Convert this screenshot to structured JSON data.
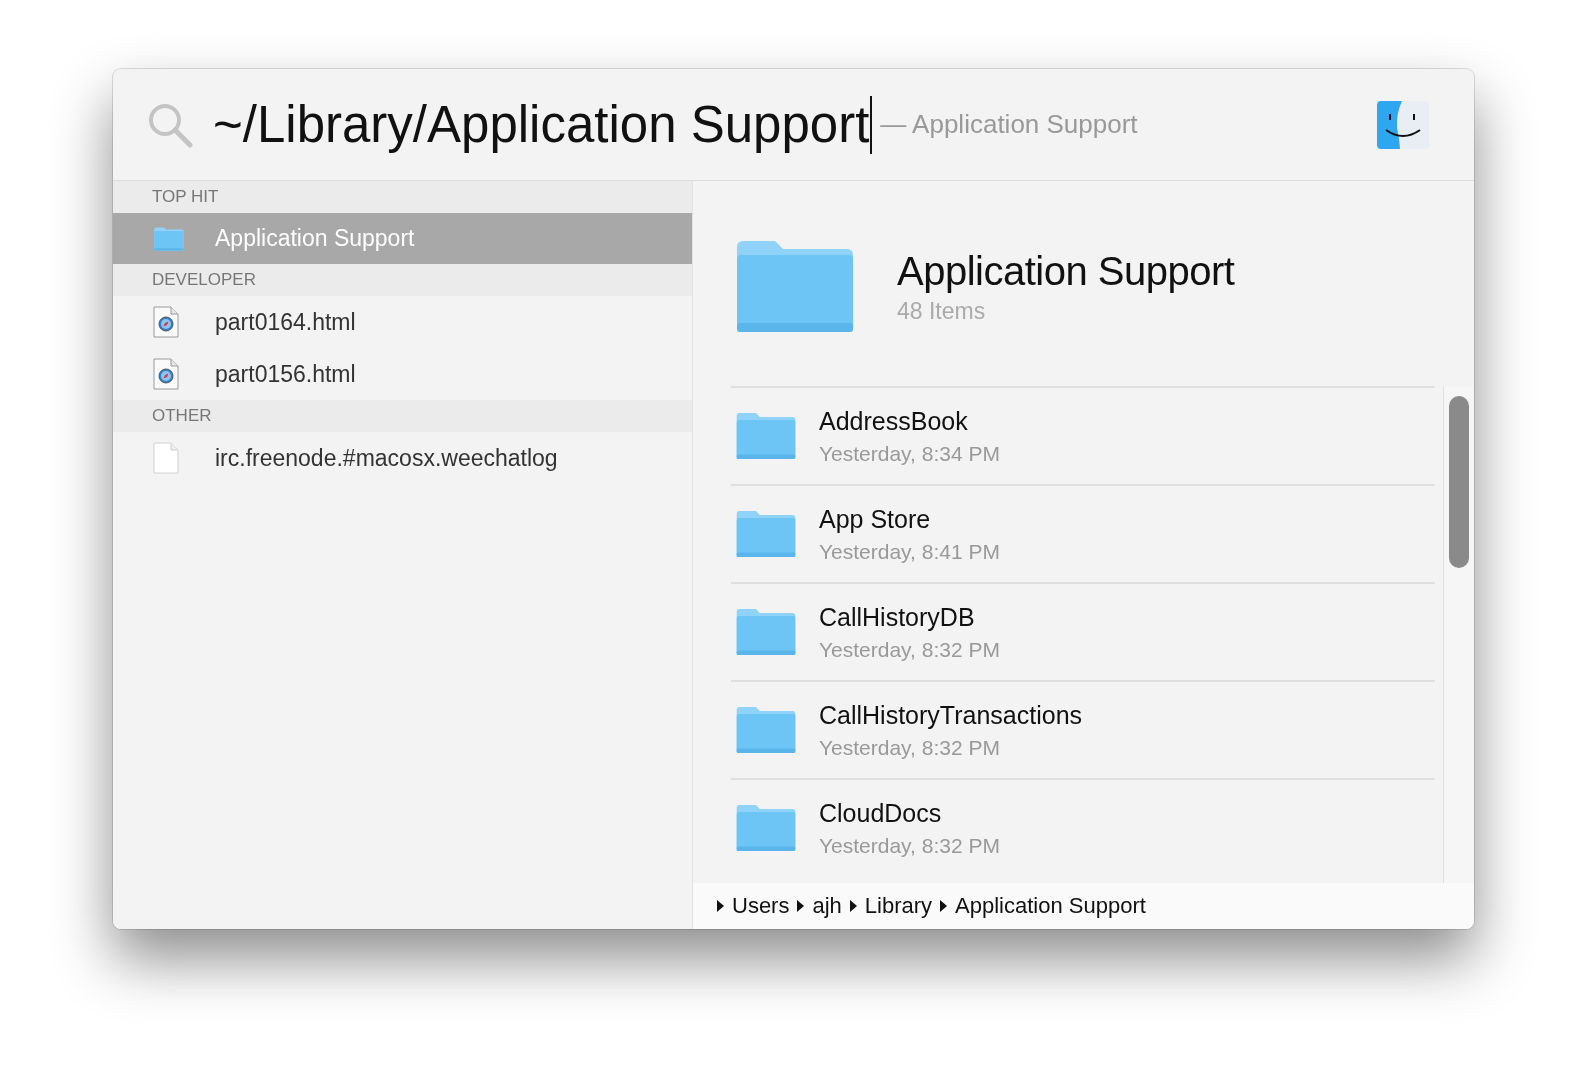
{
  "search": {
    "query": "~/Library/Application Support",
    "completion": "— Application Support"
  },
  "results": [
    {
      "section": "TOP HIT",
      "items": [
        {
          "name": "Application Support",
          "kind": "folder",
          "selected": true
        }
      ]
    },
    {
      "section": "DEVELOPER",
      "items": [
        {
          "name": "part0164.html",
          "kind": "html",
          "selected": false
        },
        {
          "name": "part0156.html",
          "kind": "html",
          "selected": false
        }
      ]
    },
    {
      "section": "OTHER",
      "items": [
        {
          "name": "irc.freenode.#macosx.weechatlog",
          "kind": "document",
          "selected": false
        }
      ]
    }
  ],
  "preview": {
    "title": "Application Support",
    "subtitle": "48 Items",
    "contents": [
      {
        "name": "AddressBook",
        "modified": "Yesterday, 8:34 PM"
      },
      {
        "name": "App Store",
        "modified": "Yesterday, 8:41 PM"
      },
      {
        "name": "CallHistoryDB",
        "modified": "Yesterday, 8:32 PM"
      },
      {
        "name": "CallHistoryTransactions",
        "modified": "Yesterday, 8:32 PM"
      },
      {
        "name": "CloudDocs",
        "modified": "Yesterday, 8:32 PM"
      }
    ]
  },
  "path": [
    "Users",
    "ajh",
    "Library",
    "Application Support"
  ]
}
